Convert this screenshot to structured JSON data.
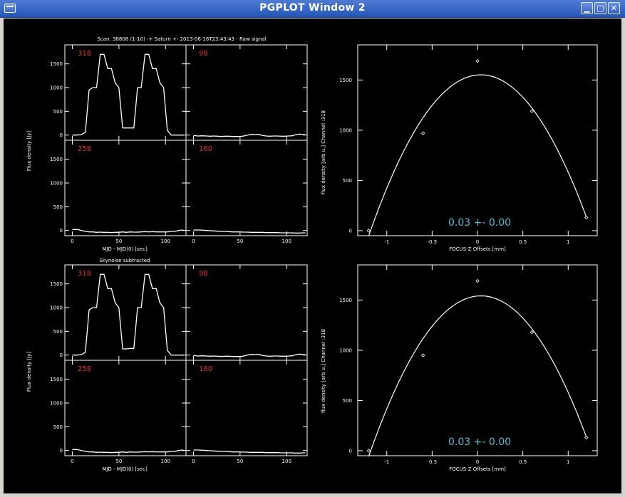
{
  "window": {
    "title": "PGPLOT Window 2",
    "buttons": {
      "minimize": "▁",
      "maximize": "□",
      "close": "✕"
    }
  },
  "colors": {
    "background": "#000000",
    "axis": "#ffffff",
    "channel_label": "#e03030",
    "fit_label": "#49c3d4"
  },
  "chart_data": [
    {
      "type": "line",
      "title": "Scan: 38808 (1-10) -+ Saturn +- 2013-06-16T23:43:43 - Raw signal",
      "xlabel": "MJD - MJD(0) [sec]",
      "ylabel": "Flux density [Jy]",
      "xlim": [
        -8,
        122
      ],
      "ylim": [
        -110,
        1900
      ],
      "xticks": [
        "0",
        "50",
        "100"
      ],
      "yticks": [
        "0",
        "500",
        "1000",
        "1500"
      ],
      "x": [
        0,
        5,
        10,
        14,
        18,
        22,
        26,
        30,
        34,
        38,
        42,
        46,
        50,
        54,
        58,
        62,
        66,
        70,
        74,
        78,
        82,
        86,
        90,
        94,
        98,
        102,
        106,
        110,
        114,
        118,
        120
      ],
      "panels": [
        {
          "channel": "318",
          "values": [
            0,
            0,
            10,
            60,
            950,
            1000,
            1000,
            1700,
            1700,
            1400,
            1400,
            1100,
            1000,
            150,
            150,
            150,
            150,
            1000,
            1000,
            1700,
            1700,
            1400,
            1400,
            1100,
            1000,
            100,
            0,
            0,
            0,
            0,
            0
          ]
        },
        {
          "channel": "98",
          "values": [
            -10,
            -20,
            -15,
            -20,
            -25,
            -20,
            -25,
            -30,
            -25,
            -25,
            -30,
            -30,
            -30,
            -20,
            0,
            15,
            10,
            15,
            -10,
            -20,
            -25,
            -20,
            -20,
            -25,
            -25,
            -20,
            -15,
            10,
            20,
            10,
            10
          ]
        },
        {
          "channel": "258",
          "values": [
            20,
            20,
            0,
            -20,
            -30,
            -30,
            -40,
            -35,
            -40,
            -40,
            -45,
            -40,
            -40,
            -30,
            -40,
            -30,
            -35,
            -35,
            -30,
            -25,
            -30,
            -25,
            -30,
            -30,
            -30,
            -30,
            -20,
            -20,
            0,
            10,
            0
          ]
        },
        {
          "channel": "160",
          "values": [
            10,
            10,
            5,
            0,
            -5,
            -10,
            -15,
            -20,
            -20,
            -25,
            -30,
            -30,
            -30,
            -35,
            -35,
            -40,
            -40,
            -40,
            -40,
            -45,
            -45,
            -45,
            -45,
            -50,
            -50,
            -50,
            -50,
            -55,
            -55,
            -50,
            -50
          ]
        }
      ]
    },
    {
      "type": "scatter",
      "xlabel": "FOCUS-Z Offsets [mm]",
      "ylabel": "flux density [arb u.] Channel :318",
      "xlim": [
        -1.32,
        1.32
      ],
      "ylim": [
        -50,
        1850
      ],
      "xticks": [
        "-1",
        "-0.5",
        "0",
        "0.5",
        "1"
      ],
      "yticks": [
        "0",
        "500",
        "1000",
        "1500"
      ],
      "points": {
        "x": [
          -1.2,
          -0.6,
          0.0,
          0.6,
          1.2
        ],
        "y": [
          0,
          970,
          1690,
          1190,
          130
        ]
      },
      "fit_label": "0.03 +- 0.00"
    },
    {
      "type": "line",
      "title": "Skynoise subtracted",
      "xlabel": "MJD - MJD(0) [sec]",
      "ylabel": "Flux density [Jy]",
      "xlim": [
        -8,
        122
      ],
      "ylim": [
        -110,
        1900
      ],
      "xticks": [
        "0",
        "50",
        "100"
      ],
      "yticks": [
        "0",
        "500",
        "1000",
        "1500"
      ],
      "x": [
        0,
        5,
        10,
        14,
        18,
        22,
        26,
        30,
        34,
        38,
        42,
        46,
        50,
        54,
        58,
        62,
        66,
        70,
        74,
        78,
        82,
        86,
        90,
        94,
        98,
        102,
        106,
        110,
        114,
        118,
        120
      ],
      "panels": [
        {
          "channel": "318",
          "values": [
            0,
            0,
            10,
            60,
            950,
            1000,
            1000,
            1700,
            1700,
            1400,
            1400,
            1100,
            1000,
            130,
            130,
            140,
            140,
            1000,
            1000,
            1700,
            1700,
            1400,
            1400,
            1100,
            1000,
            100,
            0,
            0,
            0,
            0,
            0
          ]
        },
        {
          "channel": "98",
          "values": [
            -10,
            -20,
            -15,
            -20,
            -25,
            -20,
            -25,
            -30,
            -25,
            -25,
            -30,
            -30,
            -30,
            -20,
            0,
            15,
            10,
            15,
            -10,
            -20,
            -25,
            -20,
            -20,
            -25,
            -25,
            -20,
            -15,
            10,
            20,
            10,
            10
          ]
        },
        {
          "channel": "258",
          "values": [
            20,
            20,
            0,
            -20,
            -30,
            -30,
            -40,
            -35,
            -40,
            -40,
            -45,
            -40,
            -40,
            -30,
            -40,
            -30,
            -35,
            -35,
            -30,
            -25,
            -30,
            -25,
            -30,
            -30,
            -30,
            -30,
            -20,
            -20,
            0,
            10,
            0
          ]
        },
        {
          "channel": "160",
          "values": [
            10,
            10,
            5,
            0,
            -5,
            -10,
            -15,
            -20,
            -20,
            -25,
            -30,
            -30,
            -30,
            -35,
            -35,
            -40,
            -40,
            -40,
            -40,
            -45,
            -45,
            -45,
            -45,
            -50,
            -50,
            -50,
            -50,
            -55,
            -55,
            -50,
            -50
          ]
        }
      ]
    },
    {
      "type": "scatter",
      "xlabel": "FOCUS-Z Offsets [mm]",
      "ylabel": "flux density [arb u.] Channel :318",
      "xlim": [
        -1.32,
        1.32
      ],
      "ylim": [
        -50,
        1850
      ],
      "xticks": [
        "-1",
        "-0.5",
        "0",
        "0.5",
        "1"
      ],
      "yticks": [
        "0",
        "500",
        "1000",
        "1500"
      ],
      "points": {
        "x": [
          -1.2,
          -0.6,
          0.0,
          0.6,
          1.2
        ],
        "y": [
          0,
          950,
          1690,
          1180,
          130
        ]
      },
      "fit_label": "0.03 +- 0.00"
    }
  ]
}
